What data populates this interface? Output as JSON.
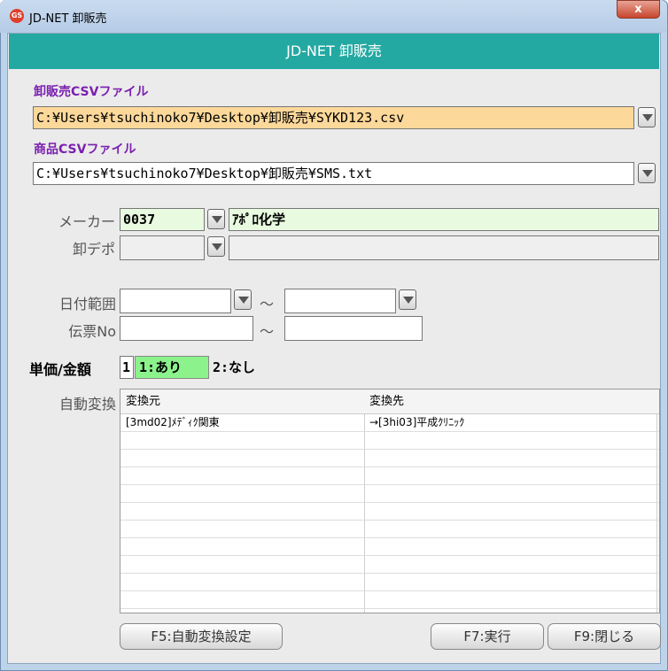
{
  "window": {
    "title": "JD-NET 卸販売",
    "icon_text": "GS",
    "close_label": "x"
  },
  "header": {
    "title": "JD-NET 卸販売"
  },
  "files": {
    "sales_csv_label": "卸販売CSVファイル",
    "sales_csv_value": "C:¥Users¥tsuchinoko7¥Desktop¥卸販売¥SYKD123.csv",
    "product_csv_label": "商品CSVファイル",
    "product_csv_value": "C:¥Users¥tsuchinoko7¥Desktop¥卸販売¥SMS.txt"
  },
  "maker": {
    "label": "メーカー",
    "code": "0037",
    "name": "ｱﾎﾟﾛ化学"
  },
  "depot": {
    "label": "卸デポ",
    "code": "",
    "name": ""
  },
  "date_range": {
    "label": "日付範囲",
    "from": "",
    "separator": "～",
    "to": ""
  },
  "slip_no": {
    "label": "伝票No",
    "from": "",
    "separator": "～",
    "to": ""
  },
  "price": {
    "label": "単価/金額",
    "value": "1",
    "option1": "1:あり",
    "option2": "2:なし"
  },
  "auto_convert": {
    "label": "自動変換",
    "columns": [
      "変換元",
      "変換先"
    ],
    "rows": [
      [
        "[3md02]ﾒﾃﾞｨｸ関東",
        "→[3hi03]平成ｸﾘﾆｯｸ"
      ]
    ]
  },
  "buttons": {
    "f5": "F5:自動変換設定",
    "f7": "F7:実行",
    "f9": "F9:閉じる"
  },
  "colors": {
    "header_teal": "#23a9a1",
    "label_purple": "#7b1fb0",
    "highlight_orange": "#fcd89a",
    "highlight_green": "#e8fae0",
    "option_green": "#8cf28c",
    "readonly_gray": "#efefef"
  }
}
